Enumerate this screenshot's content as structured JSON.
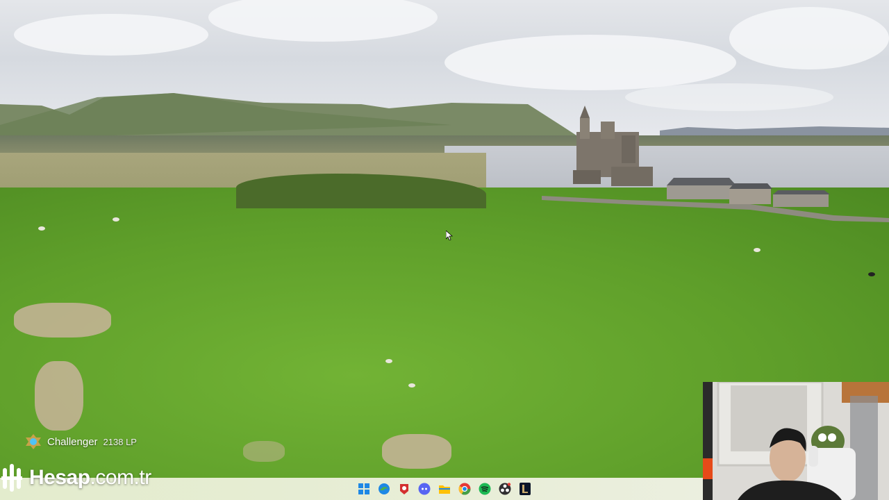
{
  "overlay": {
    "rank_tier": "Challenger",
    "rank_lp": "2138 LP"
  },
  "watermark": {
    "brand": "Hesap",
    "domain": ".com.tr"
  },
  "taskbar": {
    "icons": [
      "windows-start-icon",
      "edge-browser-icon",
      "game-client-icon",
      "discord-icon",
      "file-explorer-icon",
      "chrome-icon",
      "spotify-icon",
      "obs-icon",
      "league-of-legends-icon"
    ]
  },
  "colors": {
    "grass": "#5f9f2a",
    "sky": "#e4e6ea",
    "taskbar": "#e9eed9"
  }
}
